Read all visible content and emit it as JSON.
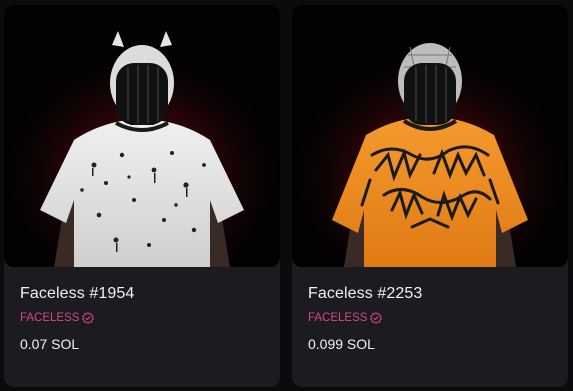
{
  "cards": [
    {
      "title": "Faceless #1954",
      "collection": "FACELESS",
      "verified_icon": "verified-badge-icon",
      "price": "0.07 SOL",
      "image": {
        "subject": "masked-figure",
        "shirt_color": "#e4e4e4",
        "glow_color": "#c41a1a"
      }
    },
    {
      "title": "Faceless #2253",
      "collection": "FACELESS",
      "verified_icon": "verified-badge-icon",
      "price": "0.099 SOL",
      "image": {
        "subject": "masked-figure",
        "shirt_color": "#ee8b22",
        "glow_color": "#c41a1a"
      }
    }
  ],
  "colors": {
    "page_background": "#0b0b0e",
    "card_background": "#1b1b20",
    "collection_accent": "#d6488f",
    "text_primary": "#f2f2f4"
  }
}
